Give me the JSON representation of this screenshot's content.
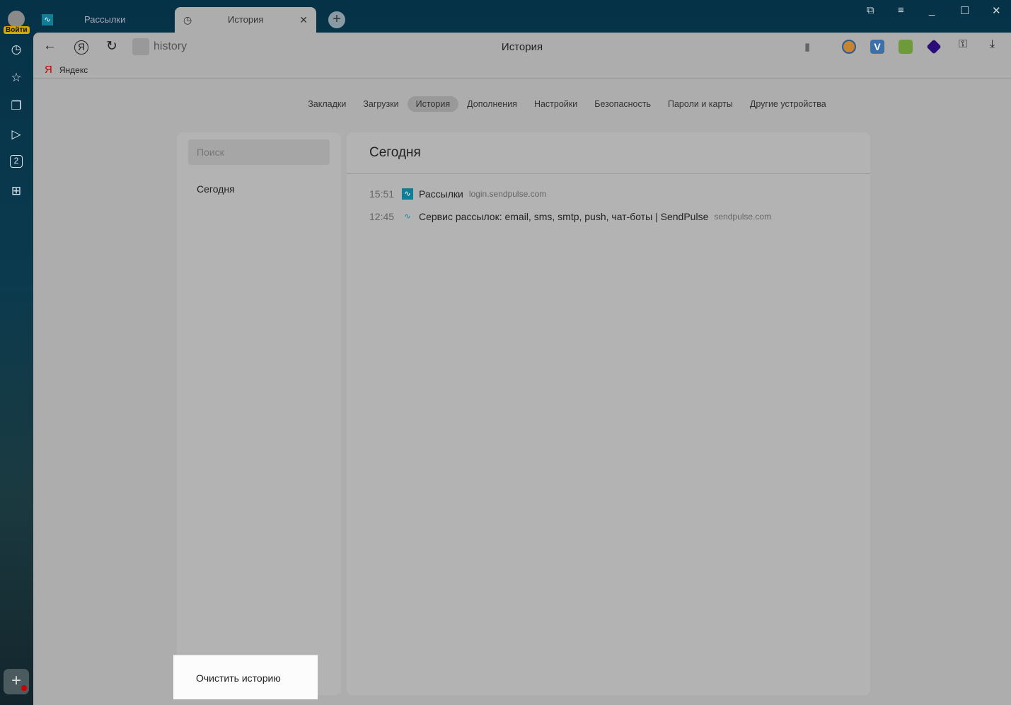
{
  "sidebar": {
    "login_label": "Войти",
    "tab_count": "2"
  },
  "tabs": [
    {
      "label": "Рассылки"
    },
    {
      "label": "История"
    }
  ],
  "toolbar": {
    "address": "history",
    "page_title": "История"
  },
  "bookmarks": [
    {
      "label": "Яндекс"
    }
  ],
  "nav": [
    "Закладки",
    "Загрузки",
    "История",
    "Дополнения",
    "Настройки",
    "Безопасность",
    "Пароли и карты",
    "Другие устройства"
  ],
  "left": {
    "search_placeholder": "Поиск",
    "group": "Сегодня",
    "clear_label": "Очистить историю"
  },
  "main": {
    "heading": "Сегодня",
    "entries": [
      {
        "time": "15:51",
        "title": "Рассылки",
        "domain": "login.sendpulse.com"
      },
      {
        "time": "12:45",
        "title": "Сервис рассылок: email, sms, smtp, push, чат-боты | SendPulse",
        "domain": "sendpulse.com"
      }
    ]
  },
  "colors": {
    "accent": "#127e96",
    "login_badge": "#d4a800"
  }
}
